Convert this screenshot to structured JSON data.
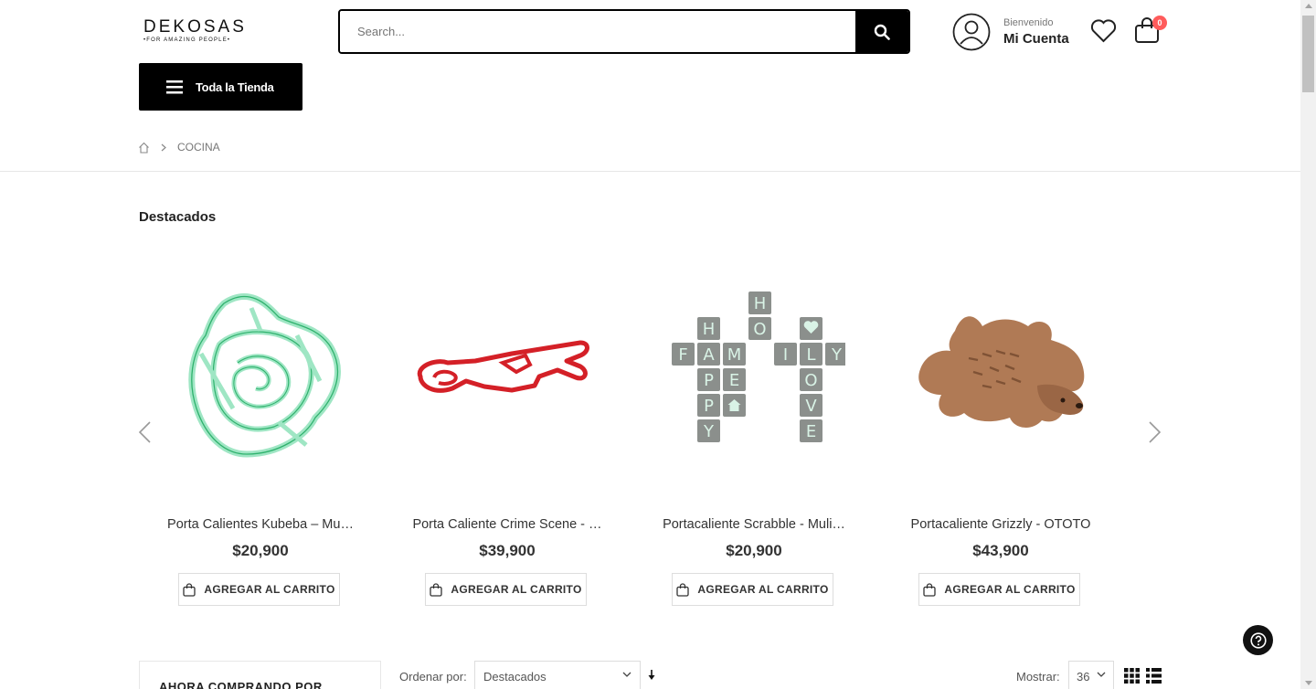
{
  "header": {
    "logo_main": "DEKOSAS",
    "logo_sub": "•FOR AMAZING PEOPLE•",
    "search_placeholder": "Search...",
    "account_greeting": "Bienvenido",
    "account_label": "Mi Cuenta",
    "cart_count": "0",
    "all_store_label": "Toda la Tienda"
  },
  "breadcrumb": {
    "items": [
      "COCINA"
    ]
  },
  "featured": {
    "title": "Destacados",
    "products": [
      {
        "name": "Porta Calientes Kubeba – Mu…",
        "price": "$20,900",
        "button": "AGREGAR AL CARRITO"
      },
      {
        "name": "Porta Caliente Crime Scene - …",
        "price": "$39,900",
        "button": "AGREGAR AL CARRITO"
      },
      {
        "name": "Portacaliente Scrabble - Muli…",
        "price": "$20,900",
        "button": "AGREGAR AL CARRITO"
      },
      {
        "name": "Portacaliente Grizzly - OTOTO",
        "price": "$43,900",
        "button": "AGREGAR AL CARRITO"
      }
    ]
  },
  "scrabble_tiles": [
    "H",
    "H",
    "O",
    "F",
    "A",
    "M",
    "I",
    "L",
    "Y",
    "P",
    "E",
    "O",
    "P",
    "V",
    "Y",
    "E"
  ],
  "toolbar": {
    "filter_title": "AHORA COMPRANDO POR",
    "sort_label": "Ordenar por:",
    "sort_value": "Destacados",
    "show_label": "Mostrar:",
    "show_value": "36"
  },
  "colors": {
    "accent": "#000000",
    "badge": "#ff5b5b",
    "mint": "#9fe6c4",
    "red": "#d42027",
    "tile": "#8b8f8c",
    "bear": "#b07a55"
  }
}
